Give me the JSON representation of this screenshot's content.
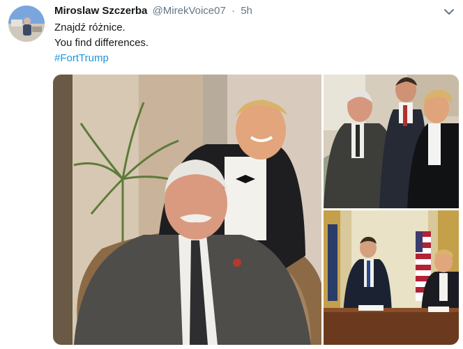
{
  "tweet": {
    "author_name": "Miroslaw Szczerba",
    "handle": "@MirekVoice07",
    "separator": "·",
    "time": "5h",
    "lines": [
      "Znajdź różnice.",
      "You find differences."
    ],
    "hashtag": "#FortTrump"
  },
  "icons": {
    "menu": "chevron-down-icon"
  },
  "colors": {
    "link": "#1b95e0",
    "secondary_text": "#657786",
    "primary_text": "#14171a"
  }
}
